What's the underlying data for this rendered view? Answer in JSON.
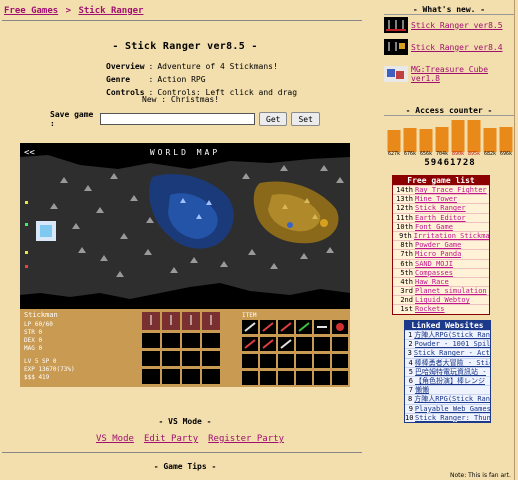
{
  "breadcrumb": {
    "home": "Free Games",
    "separator": ">",
    "current": "Stick Ranger"
  },
  "game": {
    "title": "- Stick Ranger ver8.5 -",
    "info": [
      {
        "key": "Overview",
        "value": "Adventure of 4 Stickmans!"
      },
      {
        "key": "Genre",
        "value": "Action RPG"
      },
      {
        "key": "Controls",
        "value": "Controls: Left click and drag"
      }
    ],
    "news": "New : Christmas!",
    "save_label": "Save game :",
    "save_value": "",
    "get_button": "Get",
    "set_button": "Set",
    "map_title": "WORLD MAP",
    "map_back": "<<",
    "status": {
      "name": "Stickman",
      "lines": [
        "LP  60/60",
        "STR 0",
        "DEX 0",
        "MAG 0",
        "LV  5   SP 0",
        "EXP 13670(73%)",
        "$$$ 419"
      ],
      "item_label": "ITEM"
    }
  },
  "vs_mode": {
    "title": "- VS Mode -",
    "links": [
      "VS Mode",
      "Edit Party",
      "Register Party"
    ]
  },
  "tips_title": "- Game Tips -",
  "whats_new": {
    "title": "- What's new. -",
    "items": [
      "Stick Ranger ver8.5",
      "Stick Ranger ver8.4",
      "MG:Treasure Cube ver1.8"
    ]
  },
  "access_counter": {
    "title": "- Access counter -",
    "labels": [
      "627k",
      "676k",
      "656k",
      "704k",
      "890k",
      "895k",
      "682k",
      "696k"
    ],
    "values": [
      627,
      676,
      656,
      704,
      890,
      895,
      682,
      696
    ],
    "total": "59461728",
    "bar_color": "#e8891a"
  },
  "free_games": {
    "title": "Free game list",
    "items": [
      {
        "rank": "14th",
        "name": "Ray Trace Fighter"
      },
      {
        "rank": "13th",
        "name": "Mine Tower"
      },
      {
        "rank": "12th",
        "name": "Stick Ranger"
      },
      {
        "rank": "11th",
        "name": "Earth Editor"
      },
      {
        "rank": "10th",
        "name": "Font Game"
      },
      {
        "rank": "9th",
        "name": "Irritation Stickman"
      },
      {
        "rank": "8th",
        "name": "Powder Game"
      },
      {
        "rank": "7th",
        "name": "Micro Panda"
      },
      {
        "rank": "6th",
        "name": "SAND MOJI"
      },
      {
        "rank": "5th",
        "name": "Compasses"
      },
      {
        "rank": "4th",
        "name": "Haw Race"
      },
      {
        "rank": "3rd",
        "name": "Planet simulation"
      },
      {
        "rank": "2nd",
        "name": "Liquid Webtoy"
      },
      {
        "rank": "1st",
        "name": "Rockets"
      }
    ]
  },
  "linked_websites": {
    "title": "Linked Websites",
    "items": [
      {
        "rank": "1",
        "name": "方陣人RPG(Stick Range"
      },
      {
        "rank": "2",
        "name": "Powder - 1001 Spill"
      },
      {
        "rank": "3",
        "name": "Stick Ranger - Action"
      },
      {
        "rank": "4",
        "name": "棒棒勇者大冒險 - Stic"
      },
      {
        "rank": "5",
        "name": "巴哈姆特電玩資訊站 -"
      },
      {
        "rank": "6",
        "name": "【角色扮演】棒レンジ"
      },
      {
        "rank": "7",
        "name": "懶懶"
      },
      {
        "rank": "8",
        "name": "方陣人RPG(Stick Range"
      },
      {
        "rank": "9",
        "name": "Playable Web Games"
      },
      {
        "rank": "10",
        "name": "Stick Ranger: Thunder"
      }
    ]
  },
  "fan_note": "Note: This is fan art.",
  "colors": {
    "background": "#f3dfae",
    "link": "#a01070",
    "free_list": "#8b0000",
    "linked": "#1d3a8a"
  }
}
